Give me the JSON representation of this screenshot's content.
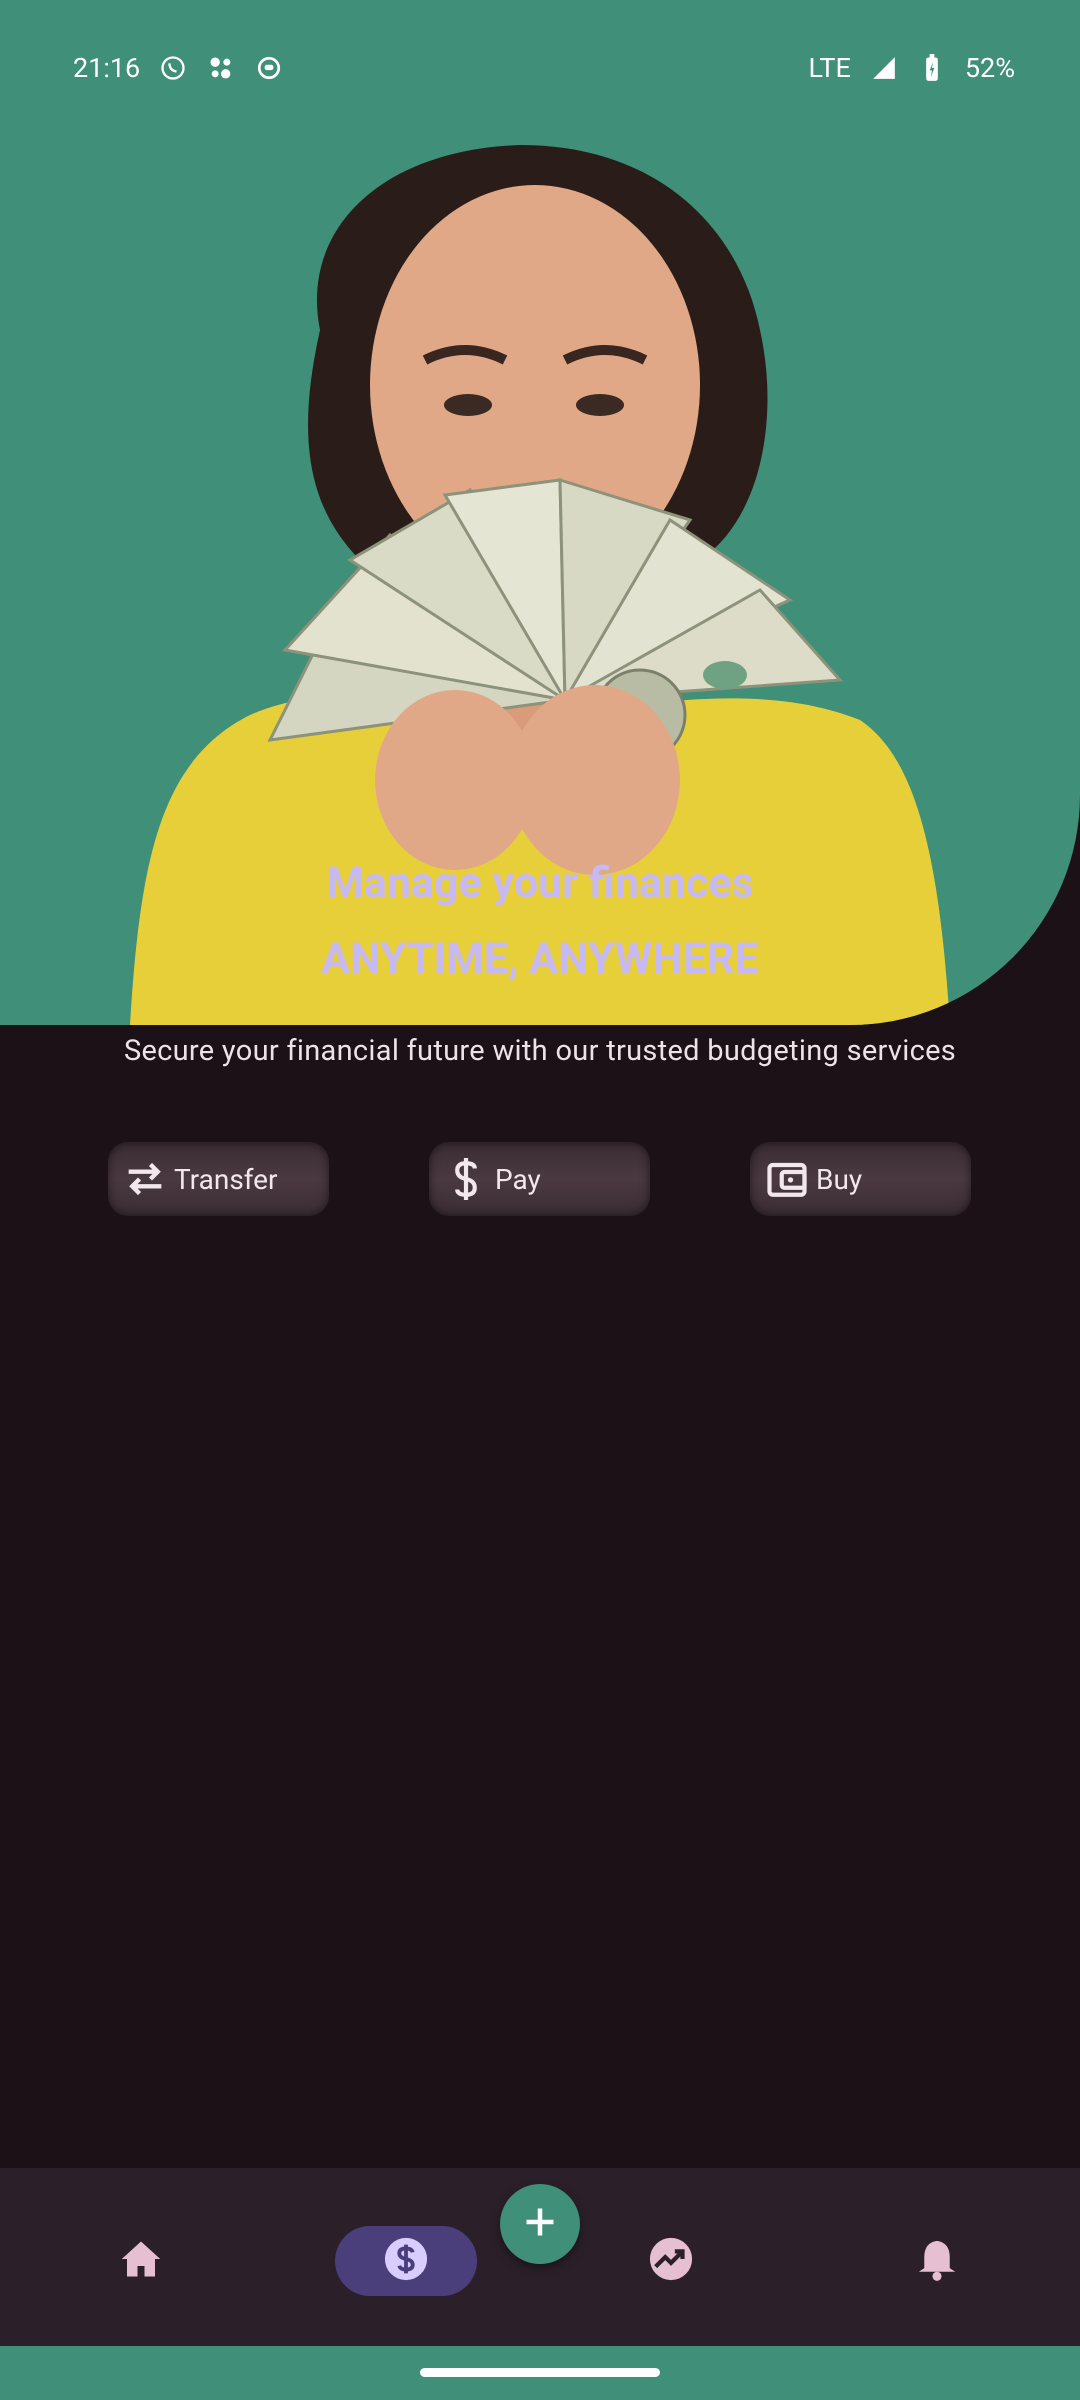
{
  "status_bar": {
    "time": "21:16",
    "network": "LTE",
    "battery": "52%",
    "notification_icons": [
      "whatsapp-icon",
      "music-icon",
      "app-icon"
    ]
  },
  "hero": {
    "title_line1": "Manage your finances",
    "title_line2": "ANYTIME, ANYWHERE",
    "subtitle": "Secure your financial future with our trusted budgeting services"
  },
  "actions": [
    {
      "label": "Transfer",
      "icon": "transfer-icon"
    },
    {
      "label": "Pay",
      "icon": "dollar-icon"
    },
    {
      "label": "Buy",
      "icon": "wallet-icon"
    }
  ],
  "bottom_nav": {
    "items": [
      "home-icon",
      "dollar-circle-icon",
      "trending-icon",
      "bell-icon"
    ],
    "active": "dollar-circle-icon",
    "fab_icon": "plus-icon"
  },
  "colors": {
    "primary_green": "#3f8f79",
    "background": "#1c1117",
    "accent_lavender": "#c7b9f4",
    "nav_active": "#4a3f7a"
  }
}
